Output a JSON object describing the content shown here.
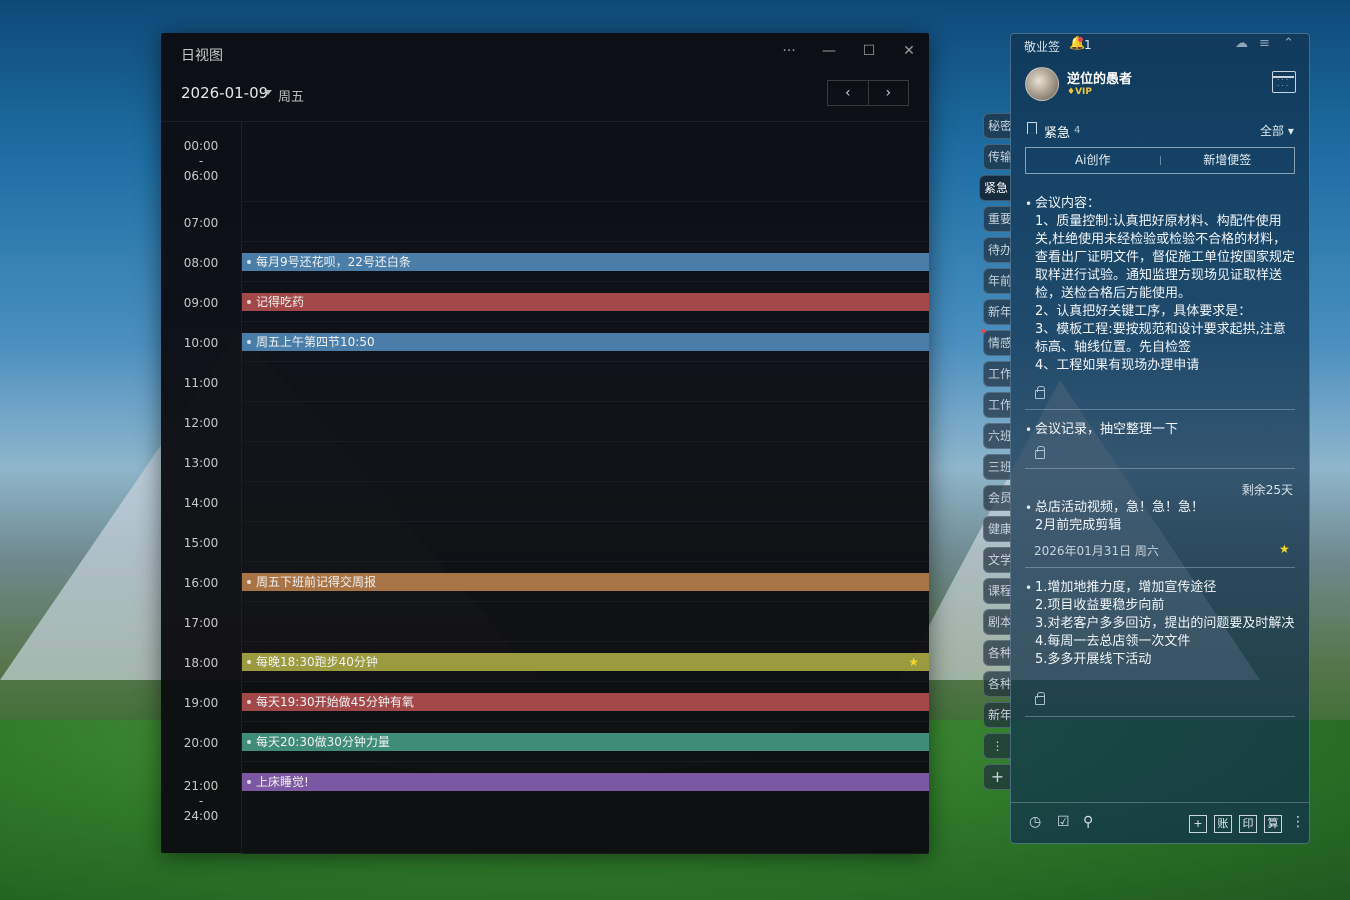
{
  "dayview": {
    "title": "日视图",
    "window_controls": {
      "more": "···",
      "minimize": "—",
      "maximize": "☐",
      "close": "✕"
    },
    "date": "2026-01-09",
    "weekday": "周五",
    "nav_prev": "‹",
    "nav_next": "›",
    "time_labels": [
      {
        "id": "t0006",
        "text": "00:00\n-\n06:00"
      },
      {
        "id": "t07",
        "text": "07:00"
      },
      {
        "id": "t08",
        "text": "08:00"
      },
      {
        "id": "t09",
        "text": "09:00"
      },
      {
        "id": "t10",
        "text": "10:00"
      },
      {
        "id": "t11",
        "text": "11:00"
      },
      {
        "id": "t12",
        "text": "12:00"
      },
      {
        "id": "t13",
        "text": "13:00"
      },
      {
        "id": "t14",
        "text": "14:00"
      },
      {
        "id": "t15",
        "text": "15:00"
      },
      {
        "id": "t16",
        "text": "16:00"
      },
      {
        "id": "t17",
        "text": "17:00"
      },
      {
        "id": "t18",
        "text": "18:00"
      },
      {
        "id": "t19",
        "text": "19:00"
      },
      {
        "id": "t20",
        "text": "20:00"
      },
      {
        "id": "t2124",
        "text": "21:00\n-\n24:00"
      }
    ],
    "events": [
      {
        "title": "每月9号还花呗，22号还白条",
        "color": "#4a7ea8",
        "starred": false
      },
      {
        "title": "记得吃药",
        "color": "#a34848",
        "starred": false
      },
      {
        "title": "周五上午第四节10:50",
        "color": "#4a7ea8",
        "starred": false
      },
      {
        "title": "周五下班前记得交周报",
        "color": "#a87446",
        "starred": false
      },
      {
        "title": "每晚18:30跑步40分钟",
        "color": "#9a9a3e",
        "starred": true
      },
      {
        "title": "每天19:30开始做45分钟有氧",
        "color": "#a34848",
        "starred": false
      },
      {
        "title": "每天20:30做30分钟力量",
        "color": "#3f8c78",
        "starred": false
      },
      {
        "title": "上床睡觉!",
        "color": "#7c58a3",
        "starred": false
      }
    ]
  },
  "side_tabs": [
    "秘密",
    "传输",
    "紧急",
    "重要",
    "待办",
    "年前",
    "新年",
    "情感",
    "工作",
    "工作",
    "六班",
    "三班",
    "会员",
    "健康",
    "文学",
    "课程",
    "剧本",
    "各种",
    "各种",
    "新年"
  ],
  "side_tabs_active": 2,
  "side_more": "⋮",
  "side_add": "+",
  "notes": {
    "app_name": "敬业签",
    "bell": "🔔",
    "notification_count": "1",
    "top_icons": {
      "cloud": "☁",
      "menu": "≡",
      "collapse": "⌃"
    },
    "user_name": "逆位的愚者",
    "vip_label": "♦VIP",
    "category": "紧急",
    "category_count": "4",
    "filter": "全部 ▾",
    "ai_button": "Ai创作",
    "new_button": "新增便签",
    "items": [
      {
        "text": "会议内容：\n1、质量控制:认真把好原材料、构配件使用关,杜绝使用未经检验或检验不合格的材料，查看出厂证明文件，督促施工单位按国家规定取样进行试验。通知监理方现场见证取样送检，送检合格后方能使用。\n2、认真把好关键工序，具体要求是：\n3、模板工程:要按规范和设计要求起拱,注意标高、轴线位置。先自检签\n4、工程如果有现场办理申请"
      },
      {
        "text": "会议记录，抽空整理一下"
      },
      {
        "text": "总店活动视频，急！急！急！\n2月前完成剪辑"
      },
      {
        "text": "1.增加地推力度，增加宣传途径\n2.项目收益要稳步向前\n3.对老客户多多回访，提出的问题要及时解决\n4.每周一去总店领一次文件\n5.多多开展线下活动"
      }
    ],
    "remaining": "剩余25天",
    "deadline": "2026年01月31日 周六",
    "footer_icons": {
      "clock": "◷",
      "check": "☑",
      "search": "⚲"
    },
    "footer_buttons": [
      "+",
      "账",
      "印",
      "算"
    ],
    "footer_more": "⋮"
  }
}
